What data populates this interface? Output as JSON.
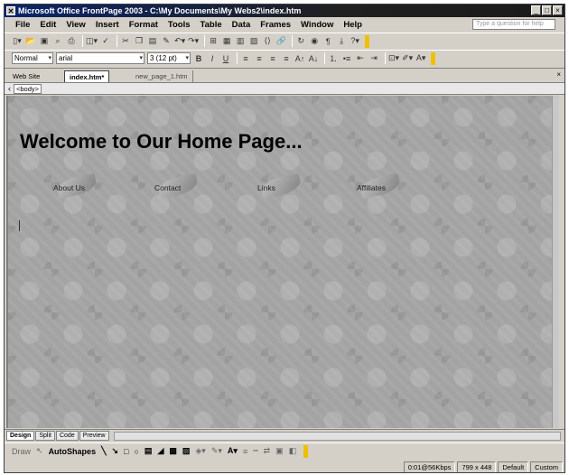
{
  "title_bar": {
    "title": "Microsoft Office FrontPage 2003 - C:\\My Documents\\My Webs2\\index.htm",
    "buttons": [
      "_",
      "□",
      "×"
    ]
  },
  "menu": {
    "items": [
      "File",
      "Edit",
      "View",
      "Insert",
      "Format",
      "Tools",
      "Table",
      "Data",
      "Frames",
      "Window",
      "Help"
    ],
    "help_placeholder": "Type a question for help"
  },
  "standard_toolbar": {
    "icons": [
      "new-page-icon",
      "open-icon",
      "save-icon",
      "search-icon",
      "print-icon",
      "preview-icon",
      "spelling-icon",
      "cut-icon",
      "copy-icon",
      "paste-icon",
      "undo-icon",
      "redo-icon",
      "table-icon",
      "frame-icon",
      "picture-icon",
      "hyperlink-icon",
      "paragraph-icon",
      "help-icon"
    ]
  },
  "formatting_toolbar": {
    "style": "Normal",
    "font": "arial",
    "size": "3 (12 pt)",
    "buttons": [
      "B",
      "I",
      "U"
    ]
  },
  "tabs": {
    "website": "Web Site",
    "index": "index.htm*",
    "newpage": "new_page_1.htm"
  },
  "tag_selector": {
    "tag": "<body>"
  },
  "page": {
    "heading": "Welcome to Our Home Page...",
    "links": [
      {
        "label": "About Us"
      },
      {
        "label": "Contact"
      },
      {
        "label": "Links"
      },
      {
        "label": "Affiliates"
      }
    ]
  },
  "view_tabs": [
    "Design",
    "Split",
    "Code",
    "Preview"
  ],
  "drawing_toolbar": {
    "draw": "Draw",
    "autoshapes": "AutoShapes"
  },
  "status_bar": {
    "download": "0:01@56Kbps",
    "dimensions": "799 x 448",
    "mode": "Default",
    "custom": "Custom"
  }
}
